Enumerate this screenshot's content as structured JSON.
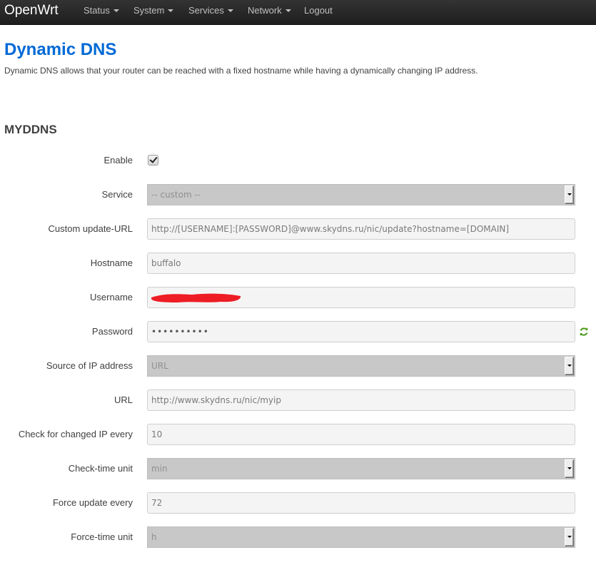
{
  "nav": {
    "brand": "OpenWrt",
    "items": [
      {
        "label": "Status",
        "dropdown": true
      },
      {
        "label": "System",
        "dropdown": true
      },
      {
        "label": "Services",
        "dropdown": true
      },
      {
        "label": "Network",
        "dropdown": true
      },
      {
        "label": "Logout",
        "dropdown": false
      }
    ]
  },
  "page": {
    "title": "Dynamic DNS",
    "description": "Dynamic DNS allows that your router can be reached with a fixed hostname while having a dynamically changing IP address."
  },
  "section": {
    "title": "MYDDNS"
  },
  "form": {
    "enable": {
      "label": "Enable",
      "checked": true
    },
    "service": {
      "label": "Service",
      "value": "-- custom --"
    },
    "custom_update_url": {
      "label": "Custom update-URL",
      "value": "http://[USERNAME]:[PASSWORD]@www.skydns.ru/nic/update?hostname=[DOMAIN]"
    },
    "hostname": {
      "label": "Hostname",
      "value": "buffalo"
    },
    "username": {
      "label": "Username",
      "value": "",
      "redacted": true
    },
    "password": {
      "label": "Password",
      "value": "••••••••••",
      "reveal_icon": "refresh-icon"
    },
    "ip_source": {
      "label": "Source of IP address",
      "value": "URL"
    },
    "url": {
      "label": "URL",
      "value": "http://www.skydns.ru/nic/myip"
    },
    "check_interval": {
      "label": "Check for changed IP every",
      "value": "10"
    },
    "check_unit": {
      "label": "Check-time unit",
      "value": "min"
    },
    "force_interval": {
      "label": "Force update every",
      "value": "72"
    },
    "force_unit": {
      "label": "Force-time unit",
      "value": "h"
    }
  },
  "colors": {
    "accent": "#0069d6",
    "navbar": "#222222",
    "redaction": "#ee1c24",
    "reveal_icon": "#4a9a1a"
  }
}
